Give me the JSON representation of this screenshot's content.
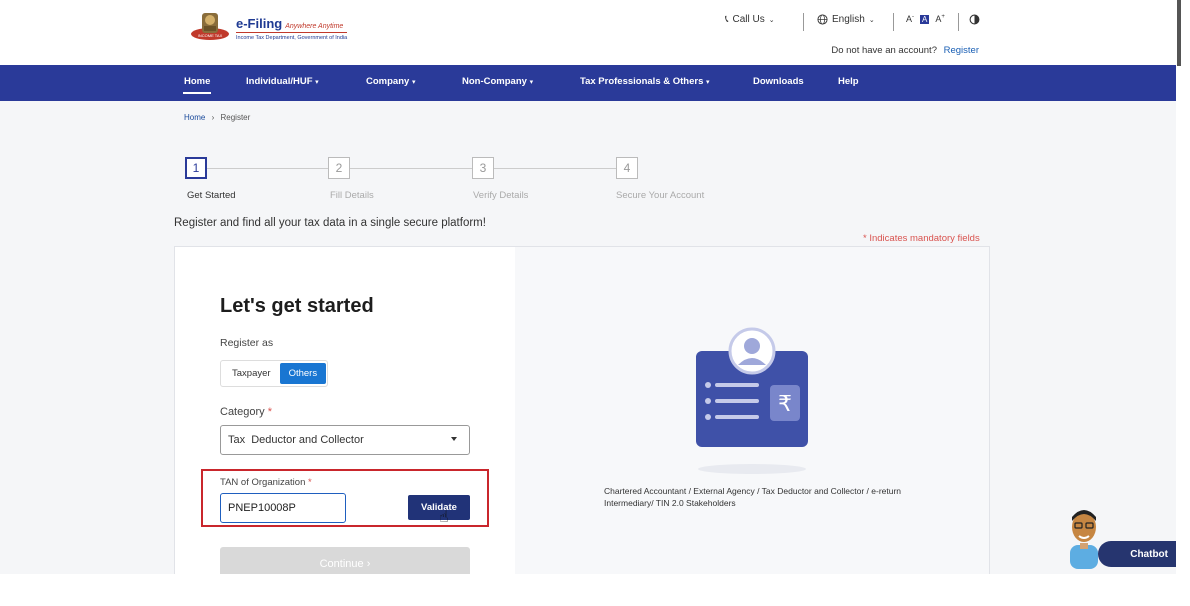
{
  "header": {
    "logo_title": "e-Filing",
    "logo_tagline": "Anywhere Anytime",
    "logo_subtitle": "Income Tax Department, Government of India",
    "call_us": "Call Us",
    "language": "English",
    "font_small": "A",
    "font_normal": "A",
    "font_large": "A",
    "no_account_text": "Do not have an account?",
    "register_link": "Register"
  },
  "nav": {
    "items": [
      {
        "label": "Home",
        "dropdown": false
      },
      {
        "label": "Individual/HUF",
        "dropdown": true
      },
      {
        "label": "Company",
        "dropdown": true
      },
      {
        "label": "Non-Company",
        "dropdown": true
      },
      {
        "label": "Tax Professionals & Others",
        "dropdown": true
      },
      {
        "label": "Downloads",
        "dropdown": false
      },
      {
        "label": "Help",
        "dropdown": false
      }
    ]
  },
  "breadcrumb": {
    "home": "Home",
    "sep": "›",
    "current": "Register"
  },
  "stepper": {
    "steps": [
      {
        "number": "1",
        "label": "Get Started"
      },
      {
        "number": "2",
        "label": "Fill Details"
      },
      {
        "number": "3",
        "label": "Verify Details"
      },
      {
        "number": "4",
        "label": "Secure Your Account"
      }
    ],
    "current_step": 1
  },
  "tagline": "Register and find all your tax data in a single secure platform!",
  "mandatory_note": "Indicates mandatory fields",
  "form": {
    "title": "Let's get started",
    "register_as_label": "Register as",
    "register_options": [
      "Taxpayer",
      "Others"
    ],
    "register_selected": "Others",
    "category_label": "Category",
    "category_value": "Tax  Deductor and Collector",
    "tan_label": "TAN of Organization",
    "tan_value": "PNEP10008P",
    "validate_label": "Validate",
    "continue_label": "Continue ›"
  },
  "right_panel": {
    "roles_text": "Chartered Accountant / External Agency / Tax Deductor and Collector / e-return Intermediary/ TIN 2.0 Stakeholders"
  },
  "chatbot": {
    "label": "Chatbot"
  },
  "colors": {
    "nav_bg": "#2a3a99",
    "primary_button": "#213378",
    "toggle_selected": "#1976d2",
    "highlight_border": "#c9262c"
  }
}
